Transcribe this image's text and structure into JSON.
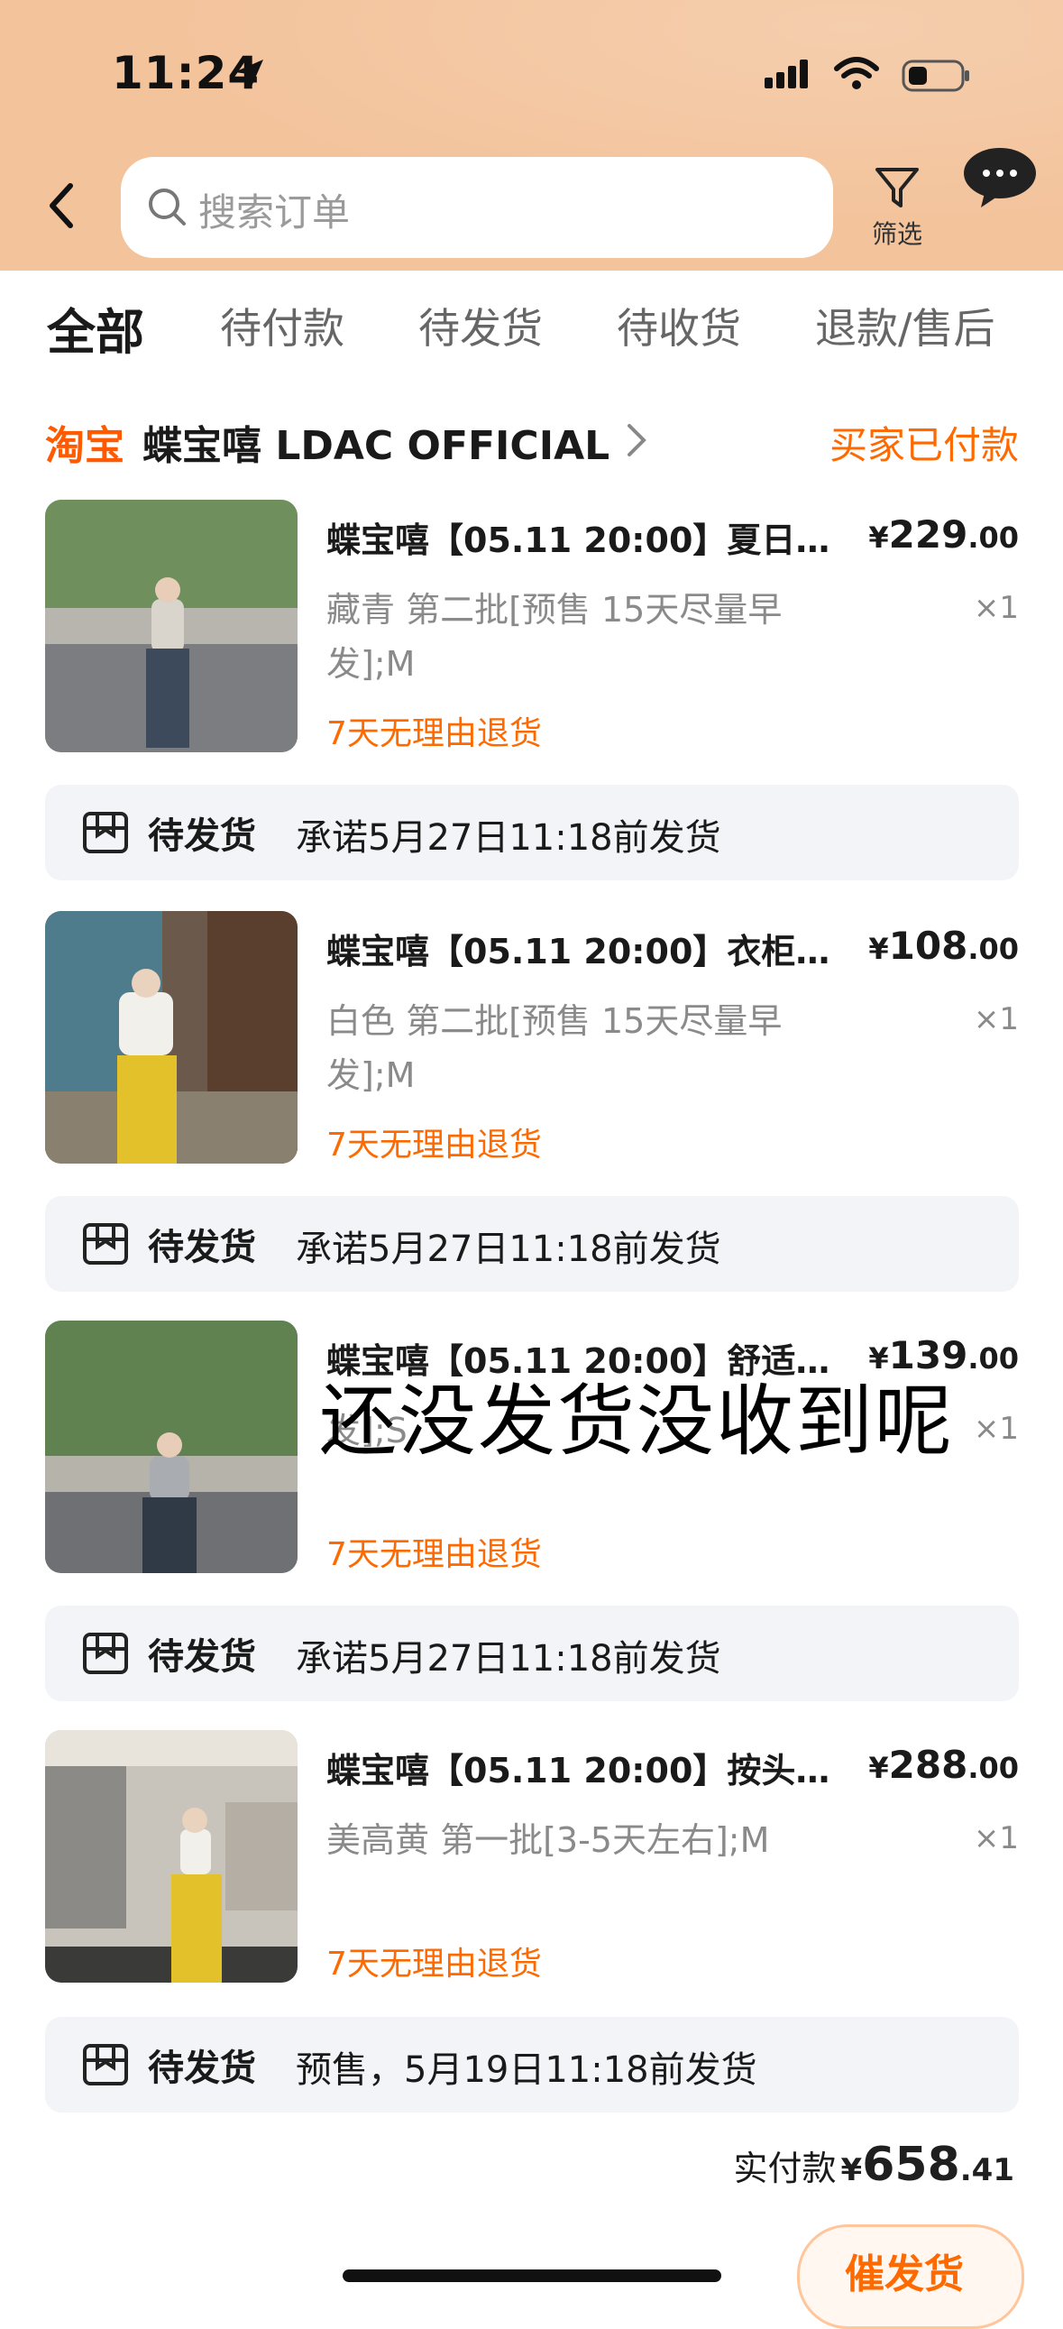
{
  "status_bar": {
    "time": "11:24"
  },
  "search": {
    "placeholder": "搜索订单"
  },
  "filter_label": "筛选",
  "tabs": [
    "全部",
    "待付款",
    "待发货",
    "待收货",
    "退款/售后"
  ],
  "store": {
    "brand": "淘宝",
    "name": "蝶宝嘻 LDAC OFFICIAL",
    "state": "买家已付款"
  },
  "items": [
    {
      "title": "蝶宝嘻【05.11 20:00】夏日呼...",
      "price_int": "229",
      "price_dec": ".00",
      "spec_line1": "藏青 第二批[预售 15天尽量早",
      "spec_line2": "发];M",
      "qty": "×1",
      "policy": "7天无理由退货",
      "ship_status": "待发货",
      "ship_promise": "承诺5月27日11:18前发货"
    },
    {
      "title": "蝶宝嘻【05.11 20:00】衣柜里...",
      "price_int": "108",
      "price_dec": ".00",
      "spec_line1": "白色 第二批[预售 15天尽量早",
      "spec_line2": "发];M",
      "qty": "×1",
      "policy": "7天无理由退货",
      "ship_status": "待发货",
      "ship_promise": "承诺5月27日11:18前发货"
    },
    {
      "title": "蝶宝嘻【05.11 20:00】舒适春...",
      "price_int": "139",
      "price_dec": ".00",
      "spec_line1": "",
      "spec_line2": "发];S",
      "qty": "×1",
      "policy": "7天无理由退货",
      "ship_status": "待发货",
      "ship_promise": "承诺5月27日11:18前发货"
    },
    {
      "title": "蝶宝嘻【05.11 20:00】按头安...",
      "price_int": "288",
      "price_dec": ".00",
      "spec_line1": "美高黄 第一批[3-5天左右];M",
      "spec_line2": "",
      "qty": "×1",
      "policy": "7天无理由退货",
      "ship_status": "待发货",
      "ship_promise": "预售，5月19日11:18前发货"
    }
  ],
  "currency": "¥",
  "overlay_caption": "还没发货没收到呢",
  "total": {
    "label": "实付款",
    "currency": "¥",
    "int": "658",
    "dec": ".41"
  },
  "urge_button": "催发货",
  "colors": {
    "header_bg": "#f3c39b",
    "accent": "#ff6a00",
    "brand": "#ff5a00",
    "ship_bg": "#f2f4f7"
  }
}
